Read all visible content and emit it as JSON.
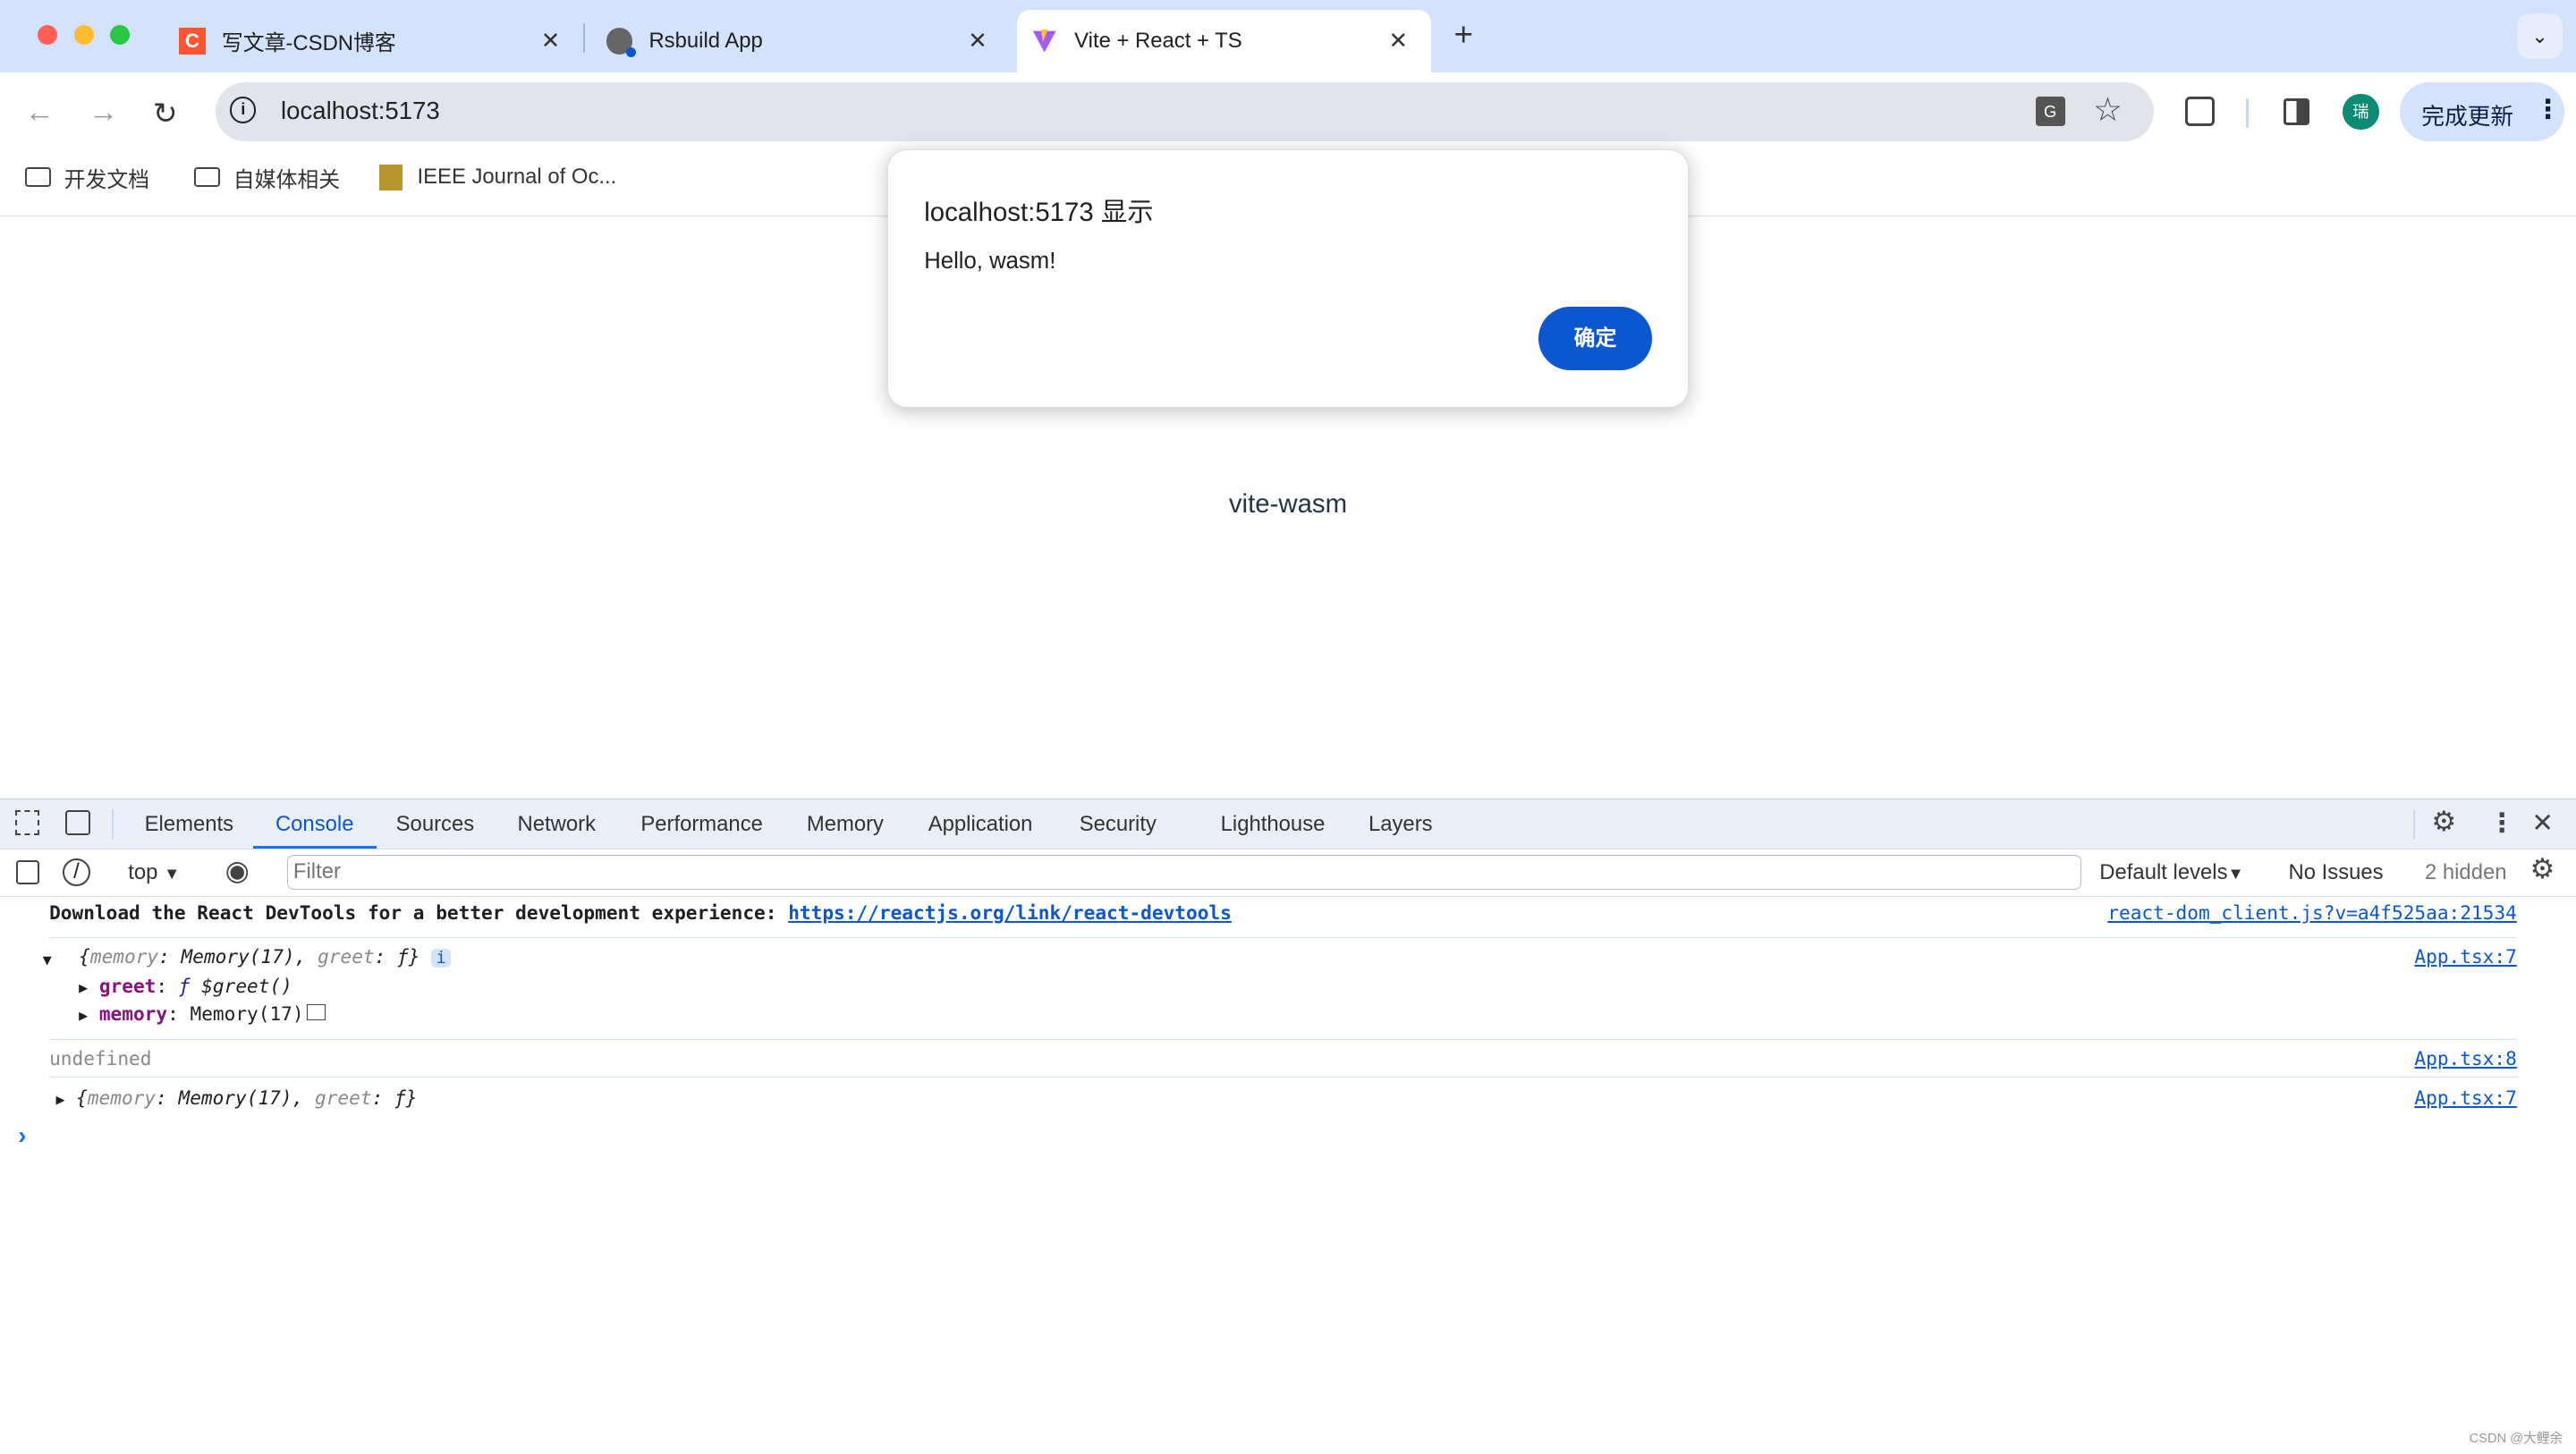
{
  "browser": {
    "tabs": [
      {
        "title": "写文章-CSDN博客",
        "icon": "csdn-icon",
        "icon_text": "C"
      },
      {
        "title": "Rsbuild App",
        "icon": "globe-icon"
      },
      {
        "title": "Vite + React + TS",
        "icon": "vite-icon",
        "active": true
      }
    ],
    "new_tab": "+",
    "url": "localhost:5173",
    "bookmarks": [
      {
        "label": "开发文档"
      },
      {
        "label": "自媒体相关"
      },
      {
        "label": "IEEE Journal of Oc..."
      }
    ],
    "profile_initial": "瑞",
    "update_button": "完成更新",
    "accent": "#0b57d0"
  },
  "dialog": {
    "title": "localhost:5173 显示",
    "message": "Hello, wasm!",
    "ok": "确定"
  },
  "page": {
    "text": "vite-wasm"
  },
  "devtools": {
    "tabs": [
      "Elements",
      "Console",
      "Sources",
      "Network",
      "Performance",
      "Memory",
      "Application",
      "Security",
      "Lighthouse",
      "Layers"
    ],
    "active_tab": "Console",
    "context": "top",
    "filter_placeholder": "Filter",
    "levels": "Default levels",
    "issues": "No Issues",
    "hidden": "2 hidden",
    "messages": {
      "m1": {
        "text": "Download the React DevTools for a better development experience: ",
        "link": "https://reactjs.org/link/react-devtools",
        "source": "react-dom_client.js?v=a4f525aa:21534"
      },
      "m2": {
        "open": "{",
        "k1": "memory",
        "v1": ": Memory(17), ",
        "k2": "greet",
        "v2": ": ƒ}",
        "info": "i",
        "source": "App.tsx:7",
        "greet_key": "greet",
        "greet_f": "ƒ",
        "greet_val": " $greet()",
        "mem_key": "memory",
        "mem_val": ": Memory(17)"
      },
      "m3": {
        "text": "undefined",
        "source": "App.tsx:8"
      },
      "m4": {
        "open": "{",
        "k1": "memory",
        "v1": ": Memory(17), ",
        "k2": "greet",
        "v2": ": ƒ}",
        "source": "App.tsx:7"
      }
    },
    "prompt": "›"
  },
  "watermark": "CSDN @大鲤余"
}
